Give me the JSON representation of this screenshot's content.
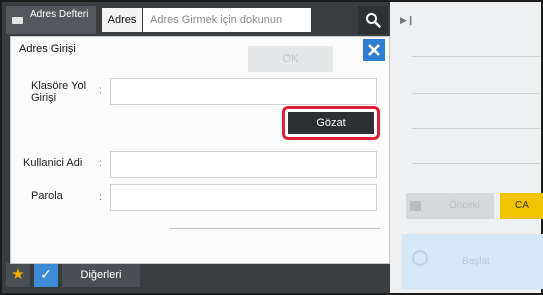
{
  "header": {
    "address_book_label": "Adres Defteri",
    "address_tab_label": "Adres",
    "address_placeholder": "Adres Girmek için dokunun"
  },
  "dialog": {
    "title": "Adres Girişi",
    "ok_label": "OK",
    "fields": {
      "folder_path_label": "Klasöre Yol Girişi",
      "username_label": "Kullanici Adi",
      "password_label": "Parola",
      "separator": ":"
    },
    "browse_label": "Gözat"
  },
  "right_panel": {
    "previous_label": "Önceki",
    "ca_label": "CA",
    "start_label": "Başlat"
  },
  "bottom_bar": {
    "others_label": "Diğerleri"
  },
  "colors": {
    "highlight": "#e01e35",
    "close_button": "#2e7fd0",
    "ca_button": "#f0c300",
    "check_button": "#3c8bd4"
  }
}
